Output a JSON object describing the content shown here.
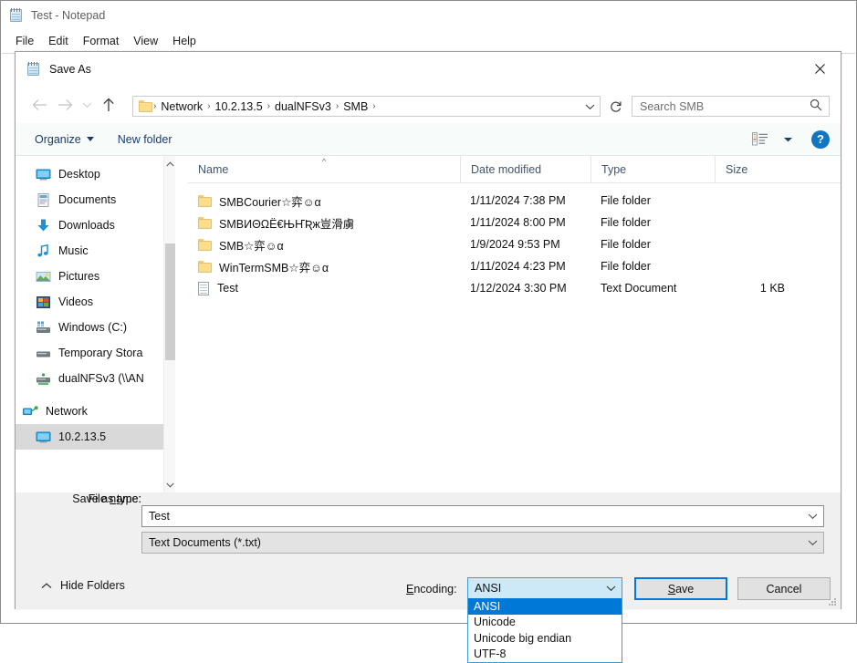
{
  "notepad": {
    "title": "Test - Notepad",
    "icon": "notepad-icon",
    "menus": [
      {
        "label": "File"
      },
      {
        "label": "Edit"
      },
      {
        "label": "Format"
      },
      {
        "label": "View"
      },
      {
        "label": "Help"
      }
    ]
  },
  "dialog": {
    "title": "Save As",
    "icon": "notepad-icon",
    "close_glyph": "✕",
    "nav": {
      "back_icon": "arrow-left-icon",
      "forward_icon": "arrow-right-icon",
      "recent_icon": "chevron-down-icon",
      "up_icon": "arrow-up-icon"
    },
    "breadcrumb": {
      "folder_icon": "folder-icon",
      "separator": "›",
      "crumbs": [
        "Network",
        "10.2.13.5",
        "dualNFSv3",
        "SMB"
      ],
      "dropdown_icon": "chevron-down-icon",
      "refresh_icon": "refresh-icon"
    },
    "search": {
      "placeholder": "Search SMB",
      "value": "",
      "icon": "search-icon"
    },
    "toolbar": {
      "organize_label": "Organize",
      "organize_icon": "caret-down-icon",
      "newfolder_label": "New folder",
      "view_icon": "view-layout-icon",
      "view_caret_icon": "caret-down-icon",
      "help_label": "?",
      "help_icon": "help-icon"
    },
    "sidebar": {
      "items": [
        {
          "label": "Desktop",
          "icon": "desktop-icon",
          "indent": "child",
          "selected": false
        },
        {
          "label": "Documents",
          "icon": "documents-icon",
          "indent": "child",
          "selected": false
        },
        {
          "label": "Downloads",
          "icon": "downloads-icon",
          "indent": "child",
          "selected": false
        },
        {
          "label": "Music",
          "icon": "music-icon",
          "indent": "child",
          "selected": false
        },
        {
          "label": "Pictures",
          "icon": "pictures-icon",
          "indent": "child",
          "selected": false
        },
        {
          "label": "Videos",
          "icon": "videos-icon",
          "indent": "child",
          "selected": false
        },
        {
          "label": "Windows (C:)",
          "icon": "drive-icon",
          "indent": "child",
          "selected": false
        },
        {
          "label": "Temporary Stora",
          "icon": "drive-icon",
          "indent": "child",
          "selected": false
        },
        {
          "label": "dualNFSv3 (\\\\AN",
          "icon": "network-drive-icon",
          "indent": "child",
          "selected": false
        },
        {
          "label": "Network",
          "icon": "network-icon",
          "indent": "root",
          "selected": false
        },
        {
          "label": "10.2.13.5",
          "icon": "computer-icon",
          "indent": "child",
          "selected": true
        }
      ],
      "scroll_up_icon": "chevron-up-icon",
      "scroll_down_icon": "chevron-down-icon"
    },
    "filelist": {
      "columns": [
        {
          "label": "Name",
          "sorted": true,
          "sort_icon": "sort-asc-icon"
        },
        {
          "label": "Date modified",
          "sorted": false
        },
        {
          "label": "Type",
          "sorted": false
        },
        {
          "label": "Size",
          "sorted": false
        }
      ],
      "rows": [
        {
          "name": "SMBCourier☆弈☺α",
          "date": "1/11/2024 7:38 PM",
          "type": "File folder",
          "size": "",
          "icon": "folder-icon"
        },
        {
          "name": "SMBИΘΩЁ€ЊҤƦж豈滑虜",
          "date": "1/11/2024 8:00 PM",
          "type": "File folder",
          "size": "",
          "icon": "folder-icon"
        },
        {
          "name": "SMB☆弈☺α",
          "date": "1/9/2024 9:53 PM",
          "type": "File folder",
          "size": "",
          "icon": "folder-icon"
        },
        {
          "name": "WinTermSMB☆弈☺α",
          "date": "1/11/2024 4:23 PM",
          "type": "File folder",
          "size": "",
          "icon": "folder-icon"
        },
        {
          "name": "Test",
          "date": "1/12/2024 3:30 PM",
          "type": "Text Document",
          "size": "1 KB",
          "icon": "text-document-icon"
        }
      ]
    },
    "form": {
      "filename_label_pre": "File ",
      "filename_label_accel": "n",
      "filename_label_post": "ame:",
      "filename_value": "Test",
      "filename_dropdown_icon": "chevron-down-icon",
      "savetype_label_pre": "Save as ",
      "savetype_label_accel": "t",
      "savetype_label_post": "ype:",
      "savetype_value": "Text Documents (*.txt)",
      "savetype_dropdown_icon": "chevron-down-icon",
      "hide_folders_label": "Hide Folders",
      "hide_folders_icon": "chevron-up-icon",
      "encoding_label_accel": "E",
      "encoding_label_post": "ncoding:",
      "encoding_value": "ANSI",
      "encoding_dropdown_icon": "chevron-down-icon",
      "encoding_options": [
        {
          "label": "ANSI",
          "selected": true
        },
        {
          "label": "Unicode",
          "selected": false
        },
        {
          "label": "Unicode big endian",
          "selected": false
        },
        {
          "label": "UTF-8",
          "selected": false
        }
      ],
      "save_label_accel": "S",
      "save_label_post": "ave",
      "cancel_label": "Cancel"
    }
  },
  "colors": {
    "accent": "#0078d7",
    "selection_blue": "#0078d7",
    "combo_highlight": "#cde8f7",
    "toolbar_bg": "#f7fbf9",
    "dialog_bg": "#f0f0f0",
    "header_text": "#40556b"
  }
}
